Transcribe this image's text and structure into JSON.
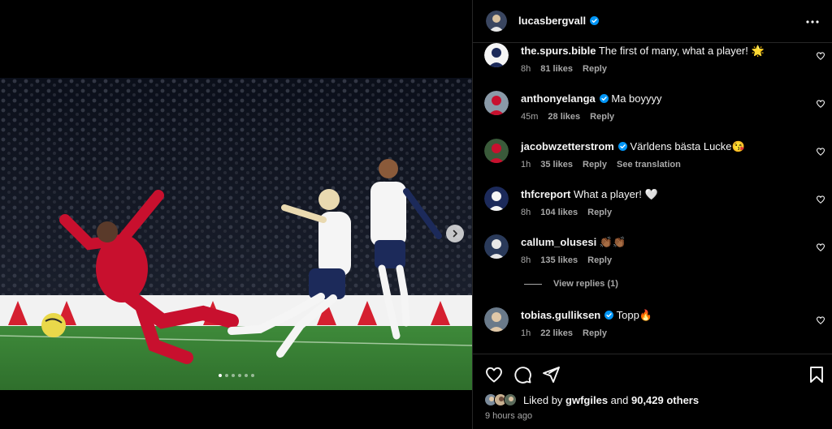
{
  "post": {
    "owner": "lucasbergvall",
    "more_label": "•••"
  },
  "comments": [
    {
      "user": "the.spurs.bible",
      "verified": false,
      "text": "The first of many, what a player! 🌟",
      "time": "8h",
      "likes": "81 likes",
      "reply": "Reply",
      "extra": ""
    },
    {
      "user": "anthonyelanga",
      "verified": true,
      "text": "Ma boyyyy",
      "time": "45m",
      "likes": "28 likes",
      "reply": "Reply",
      "extra": ""
    },
    {
      "user": "jacobwzetterstrom",
      "verified": true,
      "text": "Världens bästa Lucke😘",
      "time": "1h",
      "likes": "35 likes",
      "reply": "Reply",
      "extra": "See translation"
    },
    {
      "user": "thfcreport",
      "verified": false,
      "text": "What a player! 🤍",
      "time": "8h",
      "likes": "104 likes",
      "reply": "Reply",
      "extra": ""
    },
    {
      "user": "callum_olusesi",
      "verified": false,
      "text": "👏🏾👏🏾",
      "time": "8h",
      "likes": "135 likes",
      "reply": "Reply",
      "extra": ""
    },
    {
      "user": "tobias.gulliksen",
      "verified": true,
      "text": "Topp🔥",
      "time": "1h",
      "likes": "22 likes",
      "reply": "Reply",
      "extra": ""
    }
  ],
  "view_replies": "View replies (1)",
  "likes": {
    "prefix": "Liked by ",
    "user": "gwfgiles",
    "middle": " and ",
    "count": "90,429 others"
  },
  "time_ago": "9 hours ago",
  "carousel": {
    "count": 6,
    "active": 0
  },
  "colors": {
    "verified": "#0095f6",
    "muted": "#a8a8a8",
    "pitch": "#3c8c3c",
    "liverpool": "#c8102e"
  },
  "icons": {
    "like": "heart-icon",
    "comment": "comment-icon",
    "share": "paper-plane-icon",
    "save": "bookmark-icon",
    "more": "more-icon",
    "next": "chevron-right-icon"
  }
}
